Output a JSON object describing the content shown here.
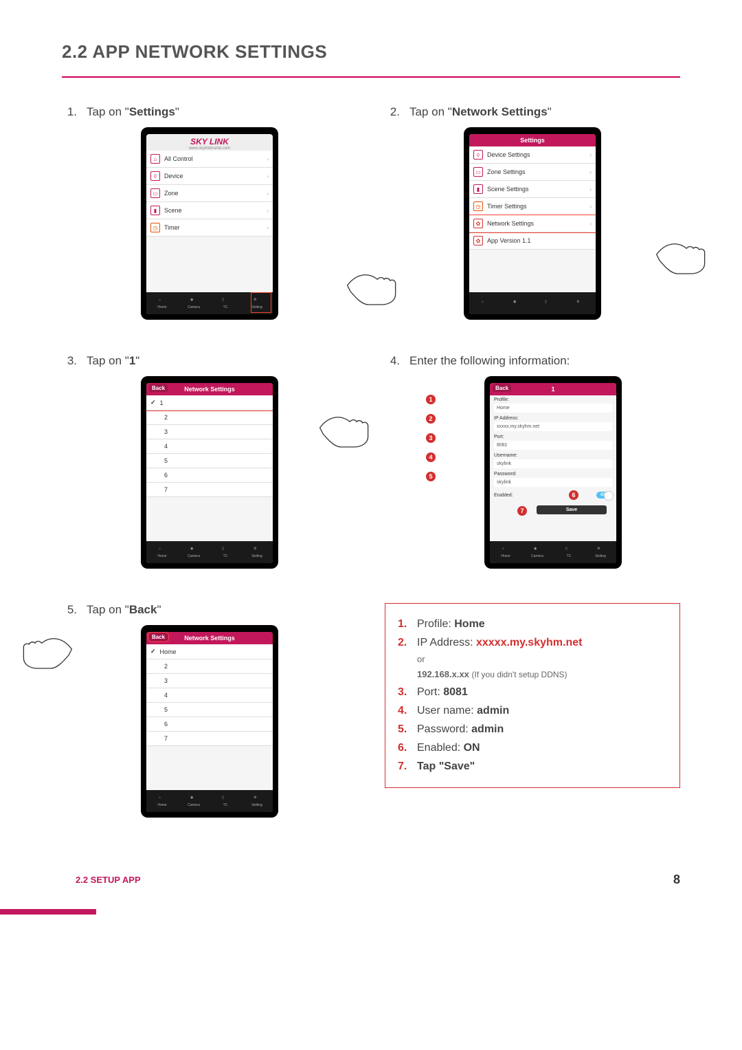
{
  "heading": "2.2 APP NETWORK SETTINGS",
  "steps": {
    "s1": {
      "num": "1.",
      "text_pre": "Tap on \"",
      "bold": "Settings",
      "text_post": "\""
    },
    "s2": {
      "num": "2.",
      "text_pre": "Tap on \"",
      "bold": "Network Settings",
      "text_post": "\""
    },
    "s3": {
      "num": "3.",
      "text_pre": "Tap on \"",
      "bold": "1",
      "text_post": "\""
    },
    "s4": {
      "num": "4.",
      "text_pre": "Enter the following information:",
      "bold": "",
      "text_post": ""
    },
    "s5": {
      "num": "5.",
      "text_pre": "Tap on \"",
      "bold": "Back",
      "text_post": "\""
    }
  },
  "phone1": {
    "logo": "SKY LINK",
    "url": "www.skylinkhome.com",
    "rows": [
      "All Control",
      "Device",
      "Zone",
      "Scene",
      "Timer"
    ],
    "tabs": [
      "Home",
      "Camera",
      "TC",
      "Setting"
    ]
  },
  "phone2": {
    "header": "Settings",
    "rows": [
      "Device Settings",
      "Zone Settings",
      "Scene Settings",
      "Timer Settings",
      "Network Settings",
      "App Version 1.1"
    ]
  },
  "phone3": {
    "header": "Network Settings",
    "back": "Back",
    "rows": [
      "1",
      "2",
      "3",
      "4",
      "5",
      "6",
      "7"
    ]
  },
  "phone4": {
    "header": "1",
    "back": "Back",
    "fields": {
      "profile_lbl": "Profile:",
      "profile_val": "Home",
      "ip_lbl": "IP Address:",
      "ip_val": "xxxxx.my.skyhm.net",
      "port_lbl": "Port:",
      "port_val": "8081",
      "user_lbl": "Username:",
      "user_val": "skylink",
      "pass_lbl": "Password:",
      "pass_val": "skylink",
      "enabled_lbl": "Enabled:",
      "toggle": "ON",
      "save": "Save"
    },
    "callouts": [
      "1",
      "2",
      "3",
      "4",
      "5",
      "6",
      "7"
    ]
  },
  "phone5": {
    "header": "Network Settings",
    "back": "Back",
    "rows": [
      "Home",
      "2",
      "3",
      "4",
      "5",
      "6",
      "7"
    ]
  },
  "infobox": {
    "i1": {
      "n": "1.",
      "label": "Profile: ",
      "val": "Home"
    },
    "i2": {
      "n": "2.",
      "label": "IP Address: ",
      "val": "xxxxx.my.skyhm.net",
      "or": "or",
      "alt": "192.168.x.xx ",
      "alt_note": "(If you didn't setup DDNS)"
    },
    "i3": {
      "n": "3.",
      "label": "Port: ",
      "val": "8081"
    },
    "i4": {
      "n": "4.",
      "label": "User name: ",
      "val": "admin"
    },
    "i5": {
      "n": "5.",
      "label": "Password: ",
      "val": "admin"
    },
    "i6": {
      "n": "6.",
      "label": "Enabled: ",
      "val": "ON"
    },
    "i7": {
      "n": "7.",
      "label": "Tap \"Save\"",
      "val": ""
    }
  },
  "footer": {
    "section": "2.2 SETUP APP",
    "page": "8"
  }
}
